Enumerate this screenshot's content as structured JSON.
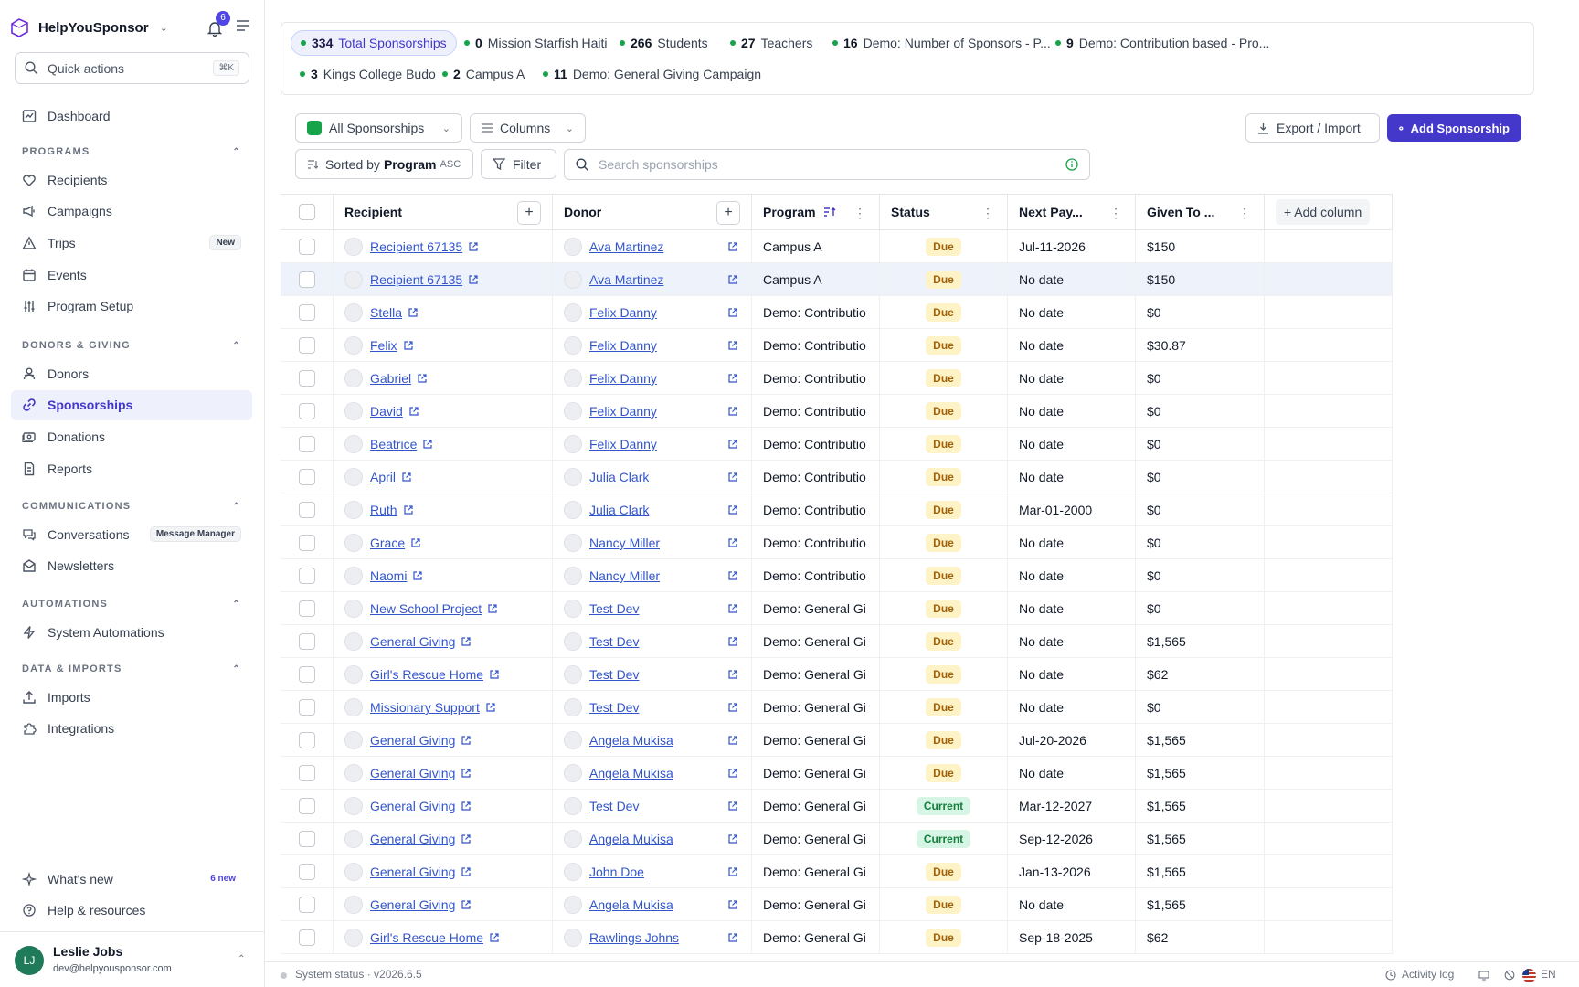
{
  "app": {
    "name": "HelpYouSponsor",
    "notifications": "6"
  },
  "quick_actions": {
    "label": "Quick actions",
    "shortcut": "⌘K"
  },
  "nav": {
    "dashboard": "Dashboard",
    "programs_header": "PROGRAMS",
    "programs": [
      {
        "label": "Recipients",
        "icon": "heart-icon"
      },
      {
        "label": "Campaigns",
        "icon": "megaphone-icon"
      },
      {
        "label": "Trips",
        "icon": "triangle-icon",
        "tag": "New"
      },
      {
        "label": "Events",
        "icon": "calendar-icon"
      },
      {
        "label": "Program Setup",
        "icon": "sliders-icon"
      }
    ],
    "donors_header": "DONORS & GIVING",
    "donors": [
      {
        "label": "Donors",
        "icon": "users-icon"
      },
      {
        "label": "Sponsorships",
        "icon": "link-icon"
      },
      {
        "label": "Donations",
        "icon": "money-icon"
      },
      {
        "label": "Reports",
        "icon": "document-icon"
      }
    ],
    "comms_header": "COMMUNICATIONS",
    "comms": [
      {
        "label": "Conversations",
        "icon": "chat-icon",
        "tag": "Message Manager"
      },
      {
        "label": "Newsletters",
        "icon": "mail-icon"
      }
    ],
    "automations_header": "AUTOMATIONS",
    "automations": [
      {
        "label": "System Automations",
        "icon": "bolt-icon"
      }
    ],
    "data_header": "DATA & IMPORTS",
    "data": [
      {
        "label": "Imports",
        "icon": "upload-icon"
      },
      {
        "label": "Integrations",
        "icon": "puzzle-icon"
      }
    ],
    "whats_new": "What's new",
    "whats_new_tag": "6 new",
    "help": "Help & resources"
  },
  "user": {
    "initials": "LJ",
    "name": "Leslie Jobs",
    "email": "dev@helpyousponsor.com"
  },
  "summary": [
    {
      "count": "334",
      "label": "Total Sponsorships"
    },
    {
      "count": "0",
      "label": "Mission Starfish Haiti"
    },
    {
      "count": "266",
      "label": "Students"
    },
    {
      "count": "27",
      "label": "Teachers"
    },
    {
      "count": "16",
      "label": "Demo: Number of Sponsors - P..."
    },
    {
      "count": "9",
      "label": "Demo: Contribution based - Pro..."
    },
    {
      "count": "3",
      "label": "Kings College Budo"
    },
    {
      "count": "2",
      "label": "Campus A"
    },
    {
      "count": "11",
      "label": "Demo: General Giving Campaign"
    }
  ],
  "toolbar": {
    "view": "All Sponsorships",
    "columns": "Columns",
    "export": "Export / Import",
    "add": "Add Sponsorship",
    "sorted_prefix": "Sorted by",
    "sorted_field": "Program",
    "sorted_dir": "ASC",
    "filter": "Filter",
    "search_placeholder": "Search sponsorships"
  },
  "columns": {
    "recipient": "Recipient",
    "donor": "Donor",
    "program": "Program",
    "status": "Status",
    "next_payment": "Next Pay...",
    "given": "Given To ...",
    "add_column": "+ Add column"
  },
  "rows": [
    {
      "recipient": "Recipient 67135",
      "donor": "Ava Martinez",
      "program": "Campus A",
      "status": "Due",
      "next": "Jul-11-2026",
      "given": "$150"
    },
    {
      "recipient": "Recipient 67135",
      "donor": "Ava Martinez",
      "program": "Campus A",
      "status": "Due",
      "next": "No date",
      "given": "$150"
    },
    {
      "recipient": "Stella",
      "donor": "Felix Danny",
      "program": "Demo: Contributio",
      "status": "Due",
      "next": "No date",
      "given": "$0"
    },
    {
      "recipient": "Felix",
      "donor": "Felix Danny",
      "program": "Demo: Contributio",
      "status": "Due",
      "next": "No date",
      "given": "$30.87"
    },
    {
      "recipient": "Gabriel",
      "donor": "Felix Danny",
      "program": "Demo: Contributio",
      "status": "Due",
      "next": "No date",
      "given": "$0"
    },
    {
      "recipient": "David",
      "donor": "Felix Danny",
      "program": "Demo: Contributio",
      "status": "Due",
      "next": "No date",
      "given": "$0"
    },
    {
      "recipient": "Beatrice",
      "donor": "Felix Danny",
      "program": "Demo: Contributio",
      "status": "Due",
      "next": "No date",
      "given": "$0"
    },
    {
      "recipient": "April",
      "donor": "Julia Clark",
      "program": "Demo: Contributio",
      "status": "Due",
      "next": "No date",
      "given": "$0"
    },
    {
      "recipient": "Ruth",
      "donor": "Julia Clark",
      "program": "Demo: Contributio",
      "status": "Due",
      "next": "Mar-01-2000",
      "given": "$0"
    },
    {
      "recipient": "Grace",
      "donor": "Nancy Miller",
      "program": "Demo: Contributio",
      "status": "Due",
      "next": "No date",
      "given": "$0"
    },
    {
      "recipient": "Naomi",
      "donor": "Nancy Miller",
      "program": "Demo: Contributio",
      "status": "Due",
      "next": "No date",
      "given": "$0"
    },
    {
      "recipient": "New School Project",
      "donor": "Test Dev",
      "program": "Demo: General Gi",
      "status": "Due",
      "next": "No date",
      "given": "$0"
    },
    {
      "recipient": "General Giving",
      "donor": "Test Dev",
      "program": "Demo: General Gi",
      "status": "Due",
      "next": "No date",
      "given": "$1,565"
    },
    {
      "recipient": "Girl's Rescue Home",
      "donor": "Test Dev",
      "program": "Demo: General Gi",
      "status": "Due",
      "next": "No date",
      "given": "$62"
    },
    {
      "recipient": "Missionary Support",
      "donor": "Test Dev",
      "program": "Demo: General Gi",
      "status": "Due",
      "next": "No date",
      "given": "$0"
    },
    {
      "recipient": "General Giving",
      "donor": "Angela Mukisa",
      "program": "Demo: General Gi",
      "status": "Due",
      "next": "Jul-20-2026",
      "given": "$1,565"
    },
    {
      "recipient": "General Giving",
      "donor": "Angela Mukisa",
      "program": "Demo: General Gi",
      "status": "Due",
      "next": "No date",
      "given": "$1,565"
    },
    {
      "recipient": "General Giving",
      "donor": "Test Dev",
      "program": "Demo: General Gi",
      "status": "Current",
      "next": "Mar-12-2027",
      "given": "$1,565"
    },
    {
      "recipient": "General Giving",
      "donor": "Angela Mukisa",
      "program": "Demo: General Gi",
      "status": "Current",
      "next": "Sep-12-2026",
      "given": "$1,565"
    },
    {
      "recipient": "General Giving",
      "donor": "John Doe",
      "program": "Demo: General Gi",
      "status": "Due",
      "next": "Jan-13-2026",
      "given": "$1,565"
    },
    {
      "recipient": "General Giving",
      "donor": "Angela Mukisa",
      "program": "Demo: General Gi",
      "status": "Due",
      "next": "No date",
      "given": "$1,565"
    },
    {
      "recipient": "Girl's Rescue Home",
      "donor": "Rawlings Johns",
      "program": "Demo: General Gi",
      "status": "Due",
      "next": "Sep-18-2025",
      "given": "$62"
    }
  ],
  "footer": {
    "system_status": "System status · v2026.6.5",
    "activity_log": "Activity log",
    "language": "EN"
  }
}
